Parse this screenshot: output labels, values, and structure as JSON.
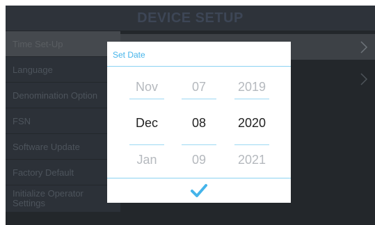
{
  "header": {
    "title": "DEVICE SETUP"
  },
  "sidebar": {
    "items": [
      {
        "label": "Time Set-Up"
      },
      {
        "label": "Language"
      },
      {
        "label": "Denomination Option"
      },
      {
        "label": "FSN"
      },
      {
        "label": "Software Update"
      },
      {
        "label": "Factory Default"
      },
      {
        "label": "Initialize Operator\nSettings"
      }
    ]
  },
  "dialog": {
    "title": "Set Date",
    "picker": {
      "month": {
        "prev": "Nov",
        "selected": "Dec",
        "next": "Jan"
      },
      "day": {
        "prev": "07",
        "selected": "08",
        "next": "09"
      },
      "year": {
        "prev": "2019",
        "selected": "2020",
        "next": "2021"
      }
    },
    "confirm_icon": "check-icon"
  },
  "colors": {
    "accent": "#45b4ea",
    "background": "#23272b",
    "active_item": "#45494e"
  }
}
